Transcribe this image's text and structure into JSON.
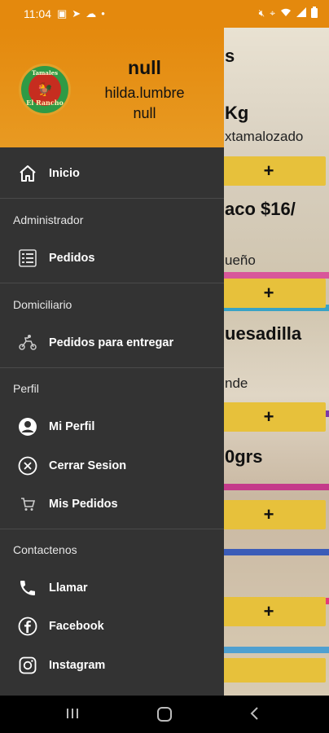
{
  "status_bar": {
    "time": "11:04"
  },
  "drawer": {
    "header": {
      "logo_text_top": "Tamales",
      "logo_text_bottom": "El Rancho",
      "name": "null",
      "username": "hilda.lumbre",
      "extra": "null"
    },
    "home": {
      "label": "Inicio"
    },
    "sections": {
      "admin": "Administrador",
      "courier": "Domiciliario",
      "profile": "Perfil",
      "contact": "Contactenos"
    },
    "items": {
      "pedidos": "Pedidos",
      "pedidos_entregar": "Pedidos para entregar",
      "mi_perfil": "Mi Perfil",
      "cerrar_sesion": "Cerrar Sesion",
      "mis_pedidos": "Mis Pedidos",
      "llamar": "Llamar",
      "facebook": "Facebook",
      "instagram": "Instagram"
    }
  },
  "background": {
    "texts": [
      "s",
      "Kg",
      "xtamalozado",
      "aco  $16/",
      "ueño",
      "uesadilla",
      "nde",
      "0grs"
    ],
    "add_label": "+"
  }
}
